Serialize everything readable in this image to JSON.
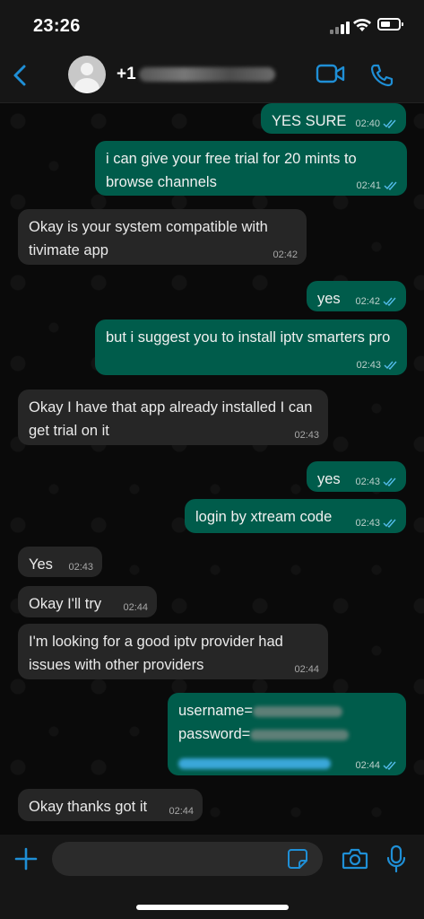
{
  "status_bar": {
    "time": "23:26"
  },
  "header": {
    "contact_prefix": "+1"
  },
  "messages": [
    {
      "dir": "out",
      "text": "YES SURE",
      "time": "02:40"
    },
    {
      "dir": "out",
      "text": "i can give your free trial for 20 mints to browse channels",
      "time": "02:41"
    },
    {
      "dir": "in",
      "text": "Okay is your system compatible with tivimate app",
      "time": "02:42"
    },
    {
      "dir": "out",
      "text": "yes",
      "time": "02:42"
    },
    {
      "dir": "out",
      "text": "but i suggest you to install iptv smarters pro",
      "time": "02:43"
    },
    {
      "dir": "in",
      "text": "Okay I have that app already installed I can get trial on it",
      "time": "02:43"
    },
    {
      "dir": "out",
      "text": "yes",
      "time": "02:43"
    },
    {
      "dir": "out",
      "text": "login by xtream code",
      "time": "02:43"
    },
    {
      "dir": "in",
      "text": "Yes",
      "time": "02:43"
    },
    {
      "dir": "in",
      "text": "Okay I'll try",
      "time": "02:44"
    },
    {
      "dir": "in",
      "text": "I'm looking for a good iptv provider had issues with other providers",
      "time": "02:44"
    },
    {
      "dir": "out",
      "username_label": "username=",
      "password_label": "password=",
      "time": "02:44"
    },
    {
      "dir": "in",
      "text": "Okay thanks got it",
      "time": "02:44"
    }
  ],
  "composer": {
    "placeholder": ""
  },
  "colors": {
    "outgoing": "#005c4b",
    "incoming": "#262626",
    "accent": "#1f8fd6",
    "read_ticks": "#53bdeb"
  },
  "icons": [
    "back-chevron-icon",
    "avatar-icon",
    "video-call-icon",
    "phone-call-icon",
    "plus-icon",
    "sticker-icon",
    "camera-icon",
    "microphone-icon",
    "double-check-icon"
  ]
}
